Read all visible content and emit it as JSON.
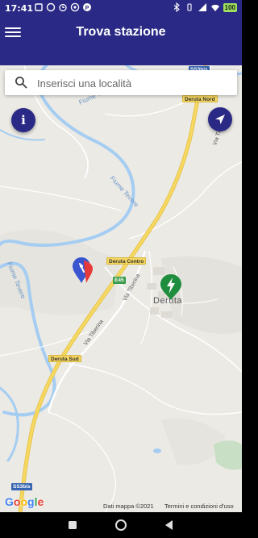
{
  "status_bar": {
    "time": "17:41",
    "battery": "100"
  },
  "app_bar": {
    "title": "Trova stazione",
    "menu_icon": "hamburger-menu-icon"
  },
  "search": {
    "placeholder": "Inserisci una località",
    "value": ""
  },
  "buttons": {
    "info_icon": "info-icon",
    "info_glyph": "i",
    "locate_icon": "navigation-arrow-icon"
  },
  "map": {
    "river_labels": [
      "Fiume Tevere",
      "Fiume Tevere",
      "Fiume Tevere"
    ],
    "road_labels": [
      "Via Tiberina",
      "Via Tiberina",
      "Via Tiberina"
    ],
    "exits": [
      "Deruta Nord",
      "Deruta Centro",
      "Deruta Sud"
    ],
    "road_shields": [
      "SS3bis",
      "E45",
      "SS3bis"
    ],
    "town": "Deruta",
    "markers": [
      "user-location-marker",
      "charging-station-marker"
    ]
  },
  "attribution": {
    "logo": "Google",
    "credits": "Dati mappa ©2021",
    "terms": "Termini e condizioni d'uso"
  },
  "colors": {
    "app_bar": "#2a2a86",
    "map_background": "#eceae5",
    "water": "#a5cdf2",
    "highway": "#f6d760",
    "station_marker": "#1e8e3e",
    "user_marker_blue": "#3a55d0",
    "user_marker_red": "#e63a3a"
  }
}
